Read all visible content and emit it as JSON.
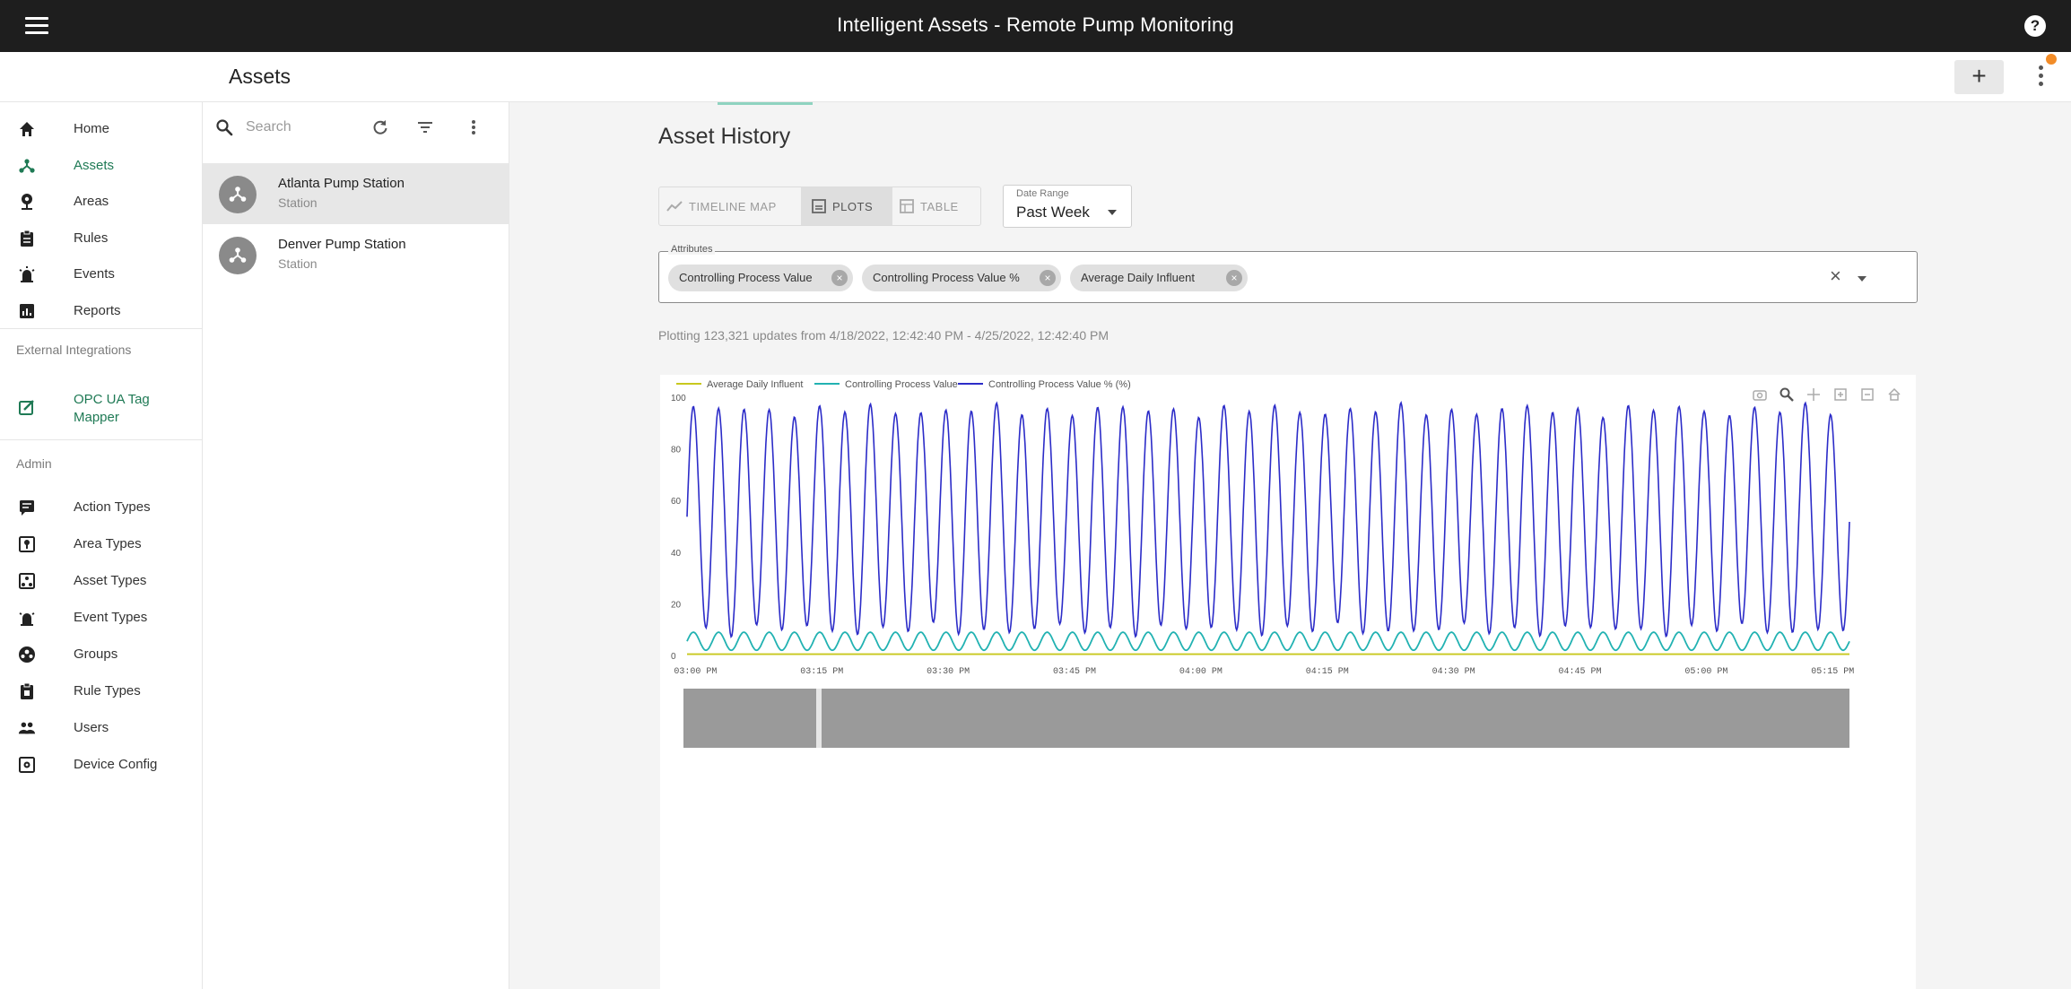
{
  "app": {
    "title": "Intelligent Assets - Remote Pump Monitoring"
  },
  "header": {
    "title": "Assets",
    "add_label": "+"
  },
  "nav": {
    "main_items": [
      {
        "label": "Home",
        "icon": "home-icon"
      },
      {
        "label": "Assets",
        "icon": "assets-icon",
        "active": true
      },
      {
        "label": "Areas",
        "icon": "pin-icon"
      },
      {
        "label": "Rules",
        "icon": "clipboard-icon"
      },
      {
        "label": "Events",
        "icon": "alarm-icon"
      },
      {
        "label": "Reports",
        "icon": "report-icon"
      }
    ],
    "external_label": "External Integrations",
    "external_items": [
      {
        "label": "OPC UA Tag Mapper",
        "icon": "edit-box-icon",
        "active": true
      }
    ],
    "admin_label": "Admin",
    "admin_items": [
      {
        "label": "Action Types",
        "icon": "action-types-icon"
      },
      {
        "label": "Area Types",
        "icon": "area-types-icon"
      },
      {
        "label": "Asset Types",
        "icon": "asset-types-icon"
      },
      {
        "label": "Event Types",
        "icon": "event-types-icon"
      },
      {
        "label": "Groups",
        "icon": "groups-icon"
      },
      {
        "label": "Rule Types",
        "icon": "rule-types-icon"
      },
      {
        "label": "Users",
        "icon": "users-icon"
      },
      {
        "label": "Device Config",
        "icon": "device-config-icon"
      }
    ]
  },
  "asset_list": {
    "search_placeholder": "Search",
    "items": [
      {
        "name": "Atlanta Pump Station",
        "type": "Station",
        "selected": true
      },
      {
        "name": "Denver Pump Station",
        "type": "Station"
      }
    ]
  },
  "history": {
    "title": "Asset History",
    "tabs": [
      {
        "label": "TIMELINE MAP",
        "icon": "timeline-icon"
      },
      {
        "label": "PLOTS",
        "icon": "plots-icon",
        "active": true
      },
      {
        "label": "TABLE",
        "icon": "table-icon"
      }
    ],
    "date_range": {
      "label": "Date Range",
      "value": "Past Week"
    },
    "attributes": {
      "label": "Attributes",
      "chips": [
        "Controlling Process Value",
        "Controlling Process Value %",
        "Average Daily Influent"
      ]
    },
    "plot_info": "Plotting 123,321 updates from 4/18/2022, 12:42:40 PM - 4/25/2022, 12:42:40 PM"
  },
  "colors": {
    "topbar": "#1e1e1e",
    "accent": "#1f7a55",
    "series_influent": "#c8c81e",
    "series_cpv": "#22b2b2",
    "series_cpv_pct": "#2c2cc8"
  },
  "chart_data": {
    "type": "line",
    "title": "",
    "xlabel": "",
    "ylabel": "",
    "ylim": [
      0,
      100
    ],
    "yticks": [
      0,
      20,
      40,
      60,
      80,
      100
    ],
    "xticks": [
      "03:00 PM",
      "03:15 PM",
      "03:30 PM",
      "03:45 PM",
      "04:00 PM",
      "04:15 PM",
      "04:30 PM",
      "04:45 PM",
      "05:00 PM",
      "05:15 PM"
    ],
    "xrange_minutes": [
      0,
      138
    ],
    "legend_position": "top-left",
    "grid": false,
    "series": [
      {
        "name": "Average Daily Influent",
        "color": "#c8c81e",
        "constant": 0.5
      },
      {
        "name": "Controlling Process Value",
        "color": "#22b2b2",
        "period_minutes": 3.0,
        "min": 2,
        "max": 9
      },
      {
        "name": "Controlling Process Value % (%)",
        "color": "#2c2cc8",
        "period_minutes": 3.0,
        "min": 10,
        "max": 95
      }
    ]
  }
}
